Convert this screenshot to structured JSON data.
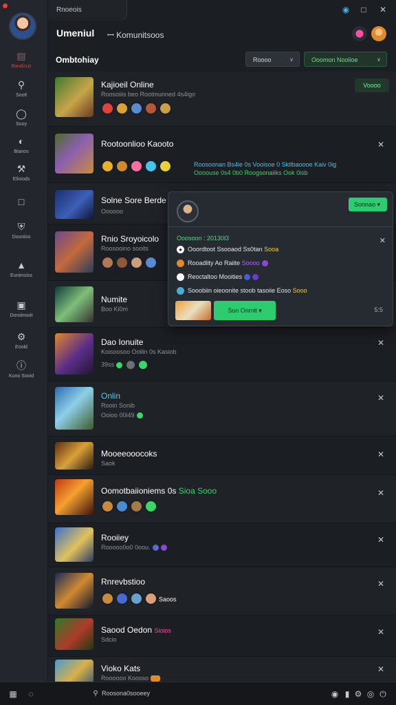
{
  "window": {
    "tab_title": "Rnoeois"
  },
  "header": {
    "brand": "Umeniul",
    "brand_accent": "",
    "subtitle": "ꟷ Komunitsoos"
  },
  "sidebar": {
    "items": [
      {
        "label": "Bandicus",
        "icon": "folder-icon",
        "active": true
      },
      {
        "label": "Sootl",
        "icon": "search-icon"
      },
      {
        "label": "Sooy",
        "icon": "chat-icon"
      },
      {
        "label": "Bianos",
        "icon": "gauge-icon"
      },
      {
        "label": "Eliniods",
        "icon": "hammer-icon"
      },
      {
        "label": "",
        "icon": "panel-icon"
      },
      {
        "label": "Douniiss",
        "icon": "shield-icon"
      },
      {
        "label": "Eunimsiss",
        "icon": "tag-icon"
      },
      {
        "label": "Doroiinsoit",
        "icon": "chest-icon"
      },
      {
        "label": "Eoold",
        "icon": "gear-icon"
      },
      {
        "label": "Kuno Sooid",
        "icon": "info-icon"
      }
    ]
  },
  "toolbar": {
    "title": "Ombtohiay",
    "filter_1": "Roooo",
    "filter_2": "Ooomon Noolioe"
  },
  "rows": [
    {
      "title": "Kajioeil Online",
      "sub": "Roosoiiis beo Rootmunned 4s4igo",
      "status": "Voooo"
    },
    {
      "title": "Rootoonlioo Kaooto",
      "sub": "",
      "note_1": "Roosoonan Bs4ie 0s Vooisoe 0 Sktlbaoooe Kaiv 0ig",
      "note_2": "Oooouse 0s4 0b0 Roogsonaiiks Ook 0isb"
    },
    {
      "title": "Solne Sore Berde",
      "sub": "Oooooo"
    },
    {
      "title": "Rnio Sroyoicolo",
      "sub": "Roosooino sooits"
    },
    {
      "title": "Numite",
      "sub": "Boo Ki0m"
    },
    {
      "title": "Dao Ionuite",
      "sub": "Koisoosoo Ooilin 0s Kasiob",
      "sub_2": "39ss"
    },
    {
      "title": "Onlin",
      "sub": "Rooin Sonib",
      "sub_2": "Ooioo 00i49"
    },
    {
      "title": "Mooeeooocoks",
      "sub": "Saok"
    },
    {
      "title": "Oomotbaiioniems 0s",
      "title_accent": "Sioa Sooo"
    },
    {
      "title": "Rooiiey",
      "sub": "Rooooo0o0 0oou."
    },
    {
      "title": "Rnrevbstioo",
      "title_accent": "Saoos"
    },
    {
      "title": "Saood Oedon",
      "title_accent": "Sioios",
      "sub": "Sdcio"
    },
    {
      "title": "Vioko Kats",
      "sub": "Roooooo Koosso"
    }
  ],
  "popover": {
    "button": "Sonnao",
    "date": "Ooosoon : 20130l3",
    "lines": [
      {
        "text": "Ooordtoot Ssooaod Ss0tan",
        "accent": "Sooa"
      },
      {
        "text": "Rooadlity Ao Raiite",
        "accent": "Soooo"
      },
      {
        "text": "Reoctaltoo Mooities",
        "accent": ""
      },
      {
        "text": "Sooobiin oieoonite stoob tasoiie Eoso",
        "accent": "Sooo"
      }
    ],
    "cta": "Sun Onmit",
    "corner": "5:5"
  },
  "bottom": {
    "status": "Roosona0sooeey"
  }
}
